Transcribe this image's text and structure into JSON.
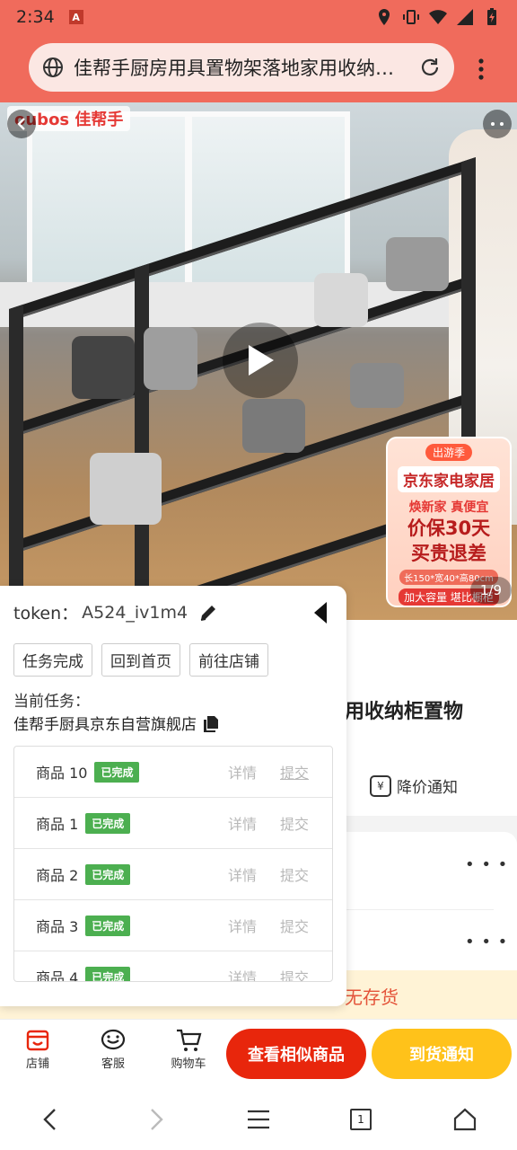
{
  "status_bar": {
    "time": "2:34",
    "app_badge": "A"
  },
  "browser": {
    "title": "佳帮手厨房用具置物架落地家用收纳柜置物架"
  },
  "hero": {
    "brand": "oubos 佳帮手",
    "pager": "1/9",
    "promo": {
      "tag": "出游季",
      "title": "京东家电家居",
      "sub": "焕新家 真便宜",
      "line1": "价保30天",
      "line2": "买贵退差",
      "dims": "长150*宽40*高80cm",
      "capacity": "加大容量 堪比橱柜"
    }
  },
  "product": {
    "title_fragment": "用收纳柜置物",
    "price_alert": "降价通知",
    "stock_text": "无存货"
  },
  "bottom_bar": {
    "store": "店铺",
    "service": "客服",
    "cart": "购物车",
    "similar_btn": "查看相似商品",
    "notify_btn": "到货通知"
  },
  "panel": {
    "token_label": "token：",
    "token_value": "A524_iv1m4",
    "actions": [
      "任务完成",
      "回到首页",
      "前往店铺"
    ],
    "current_task_label": "当前任务：",
    "current_store": "佳帮手厨具京东自营旗舰店",
    "items": [
      {
        "name": "商品 10",
        "status": "已完成",
        "detail": "详情",
        "submit": "提交"
      },
      {
        "name": "商品 1",
        "status": "已完成",
        "detail": "详情",
        "submit": "提交"
      },
      {
        "name": "商品 2",
        "status": "已完成",
        "detail": "详情",
        "submit": "提交"
      },
      {
        "name": "商品 3",
        "status": "已完成",
        "detail": "详情",
        "submit": "提交"
      },
      {
        "name": "商品 4",
        "status": "已完成",
        "detail": "详情",
        "submit": "提交"
      }
    ]
  },
  "nav": {
    "tab_count": "1"
  },
  "colors": {
    "accent": "#f06b5c",
    "badge_green": "#4caf50",
    "btn_red": "#e8260c",
    "btn_yellow": "#ffc21a"
  }
}
